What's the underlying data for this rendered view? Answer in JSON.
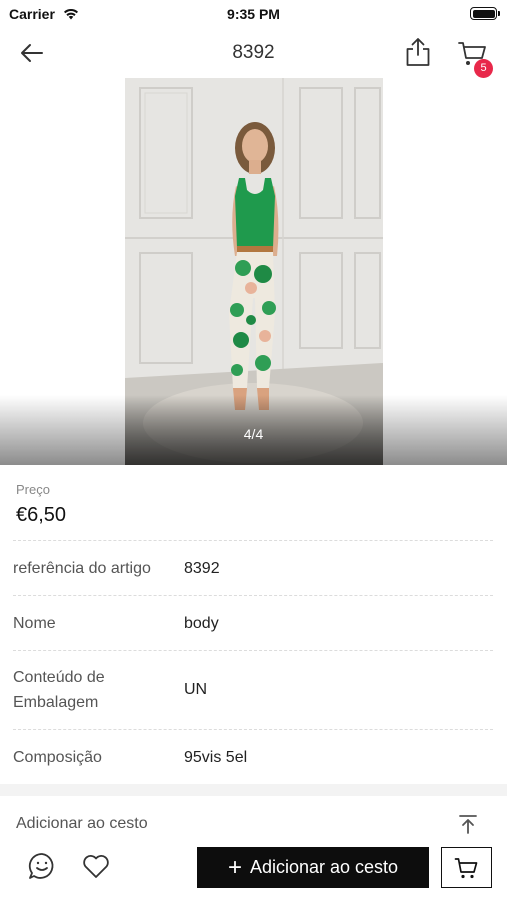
{
  "status_bar": {
    "carrier": "Carrier",
    "time": "9:35 PM"
  },
  "nav": {
    "title": "8392",
    "cart_count": "5",
    "badge_color": "#e8284a"
  },
  "gallery": {
    "counter": "4/4",
    "current": 4,
    "total": 4
  },
  "price": {
    "label": "Preço",
    "value": "€6,50"
  },
  "attributes": [
    {
      "key": "referência do artigo",
      "value": "8392"
    },
    {
      "key": "Nome",
      "value": "body"
    },
    {
      "key": "Conteúdo de Embalagem",
      "value": "UN"
    },
    {
      "key": "Composição",
      "value": "95vis 5el"
    }
  ],
  "section": {
    "add_to_cart_label": "Adicionar ao cesto"
  },
  "bottom_bar": {
    "add_button_label": "Adicionar ao cesto",
    "button_color": "#0d0d0d"
  },
  "icons": [
    "wifi-icon",
    "battery-icon",
    "back-arrow-icon",
    "share-icon",
    "cart-icon",
    "chat-icon",
    "heart-icon",
    "plus-icon",
    "scroll-top-icon"
  ]
}
